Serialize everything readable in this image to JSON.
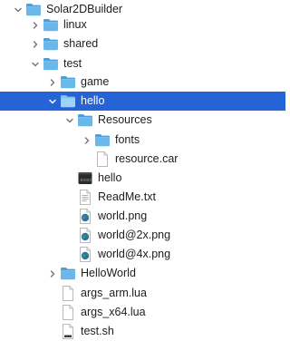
{
  "file_tree": {
    "items": [
      {
        "label": "Solar2DBuilder",
        "depth": 0,
        "icon": "folder-icon",
        "chevron": "chevron-down-icon",
        "selected": false
      },
      {
        "label": "linux",
        "depth": 1,
        "icon": "folder-icon",
        "chevron": "chevron-right-icon",
        "selected": false
      },
      {
        "label": "shared",
        "depth": 1,
        "icon": "folder-icon",
        "chevron": "chevron-right-icon",
        "selected": false
      },
      {
        "label": "test",
        "depth": 1,
        "icon": "folder-icon",
        "chevron": "chevron-down-icon",
        "selected": false
      },
      {
        "label": "game",
        "depth": 2,
        "icon": "folder-icon",
        "chevron": "chevron-right-icon",
        "selected": false
      },
      {
        "label": "hello",
        "depth": 2,
        "icon": "folder-icon",
        "chevron": "chevron-down-icon",
        "selected": true
      },
      {
        "label": "Resources",
        "depth": 3,
        "icon": "folder-icon",
        "chevron": "chevron-down-icon",
        "selected": false
      },
      {
        "label": "fonts",
        "depth": 4,
        "icon": "folder-icon",
        "chevron": "chevron-right-icon",
        "selected": false
      },
      {
        "label": "resource.car",
        "depth": 4,
        "icon": "document-icon",
        "chevron": "",
        "selected": false
      },
      {
        "label": "hello",
        "depth": 3,
        "icon": "executable-icon",
        "chevron": "",
        "selected": false
      },
      {
        "label": "ReadMe.txt",
        "depth": 3,
        "icon": "text-file-icon",
        "chevron": "",
        "selected": false
      },
      {
        "label": "world.png",
        "depth": 3,
        "icon": "image-file-icon",
        "chevron": "",
        "selected": false
      },
      {
        "label": "world@2x.png",
        "depth": 3,
        "icon": "image-file-icon",
        "chevron": "",
        "selected": false
      },
      {
        "label": "world@4x.png",
        "depth": 3,
        "icon": "image-file-icon",
        "chevron": "",
        "selected": false
      },
      {
        "label": "HelloWorld",
        "depth": 2,
        "icon": "folder-icon",
        "chevron": "chevron-right-icon",
        "selected": false
      },
      {
        "label": "args_arm.lua",
        "depth": 2,
        "icon": "document-icon",
        "chevron": "",
        "selected": false
      },
      {
        "label": "args_x64.lua",
        "depth": 2,
        "icon": "document-icon",
        "chevron": "",
        "selected": false
      },
      {
        "label": "test.sh",
        "depth": 2,
        "icon": "script-file-icon",
        "chevron": "",
        "selected": false
      }
    ],
    "colors": {
      "selection": "#2563d6",
      "folder_body": "#6cb7ea",
      "folder_tab": "#4e9fd6",
      "text": "#1d1d1f",
      "chevron": "#7a7a7a"
    }
  }
}
